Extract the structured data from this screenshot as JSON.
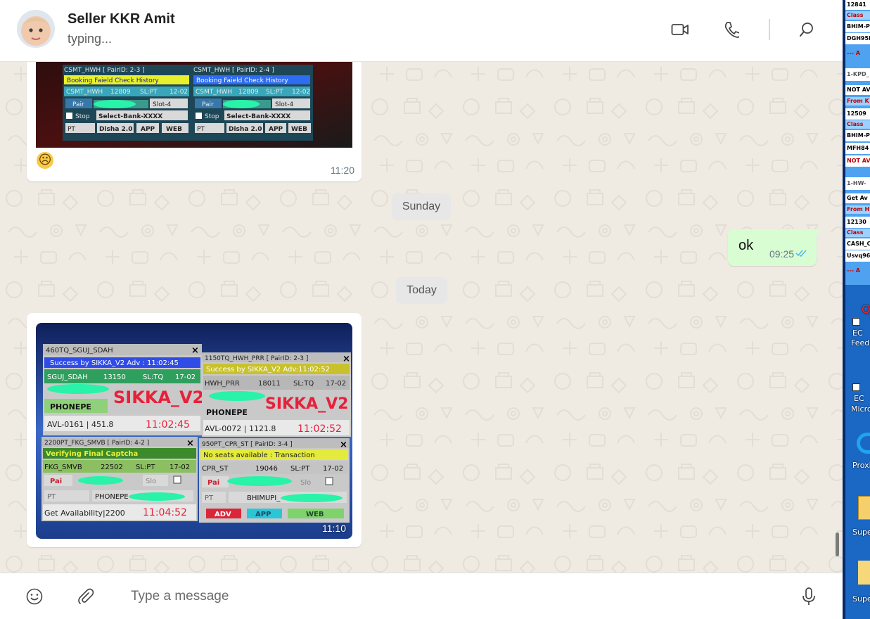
{
  "header": {
    "contact_name": "Seller KKR Amit",
    "contact_status": "typing...",
    "icons": [
      "video-call-icon",
      "voice-call-icon",
      "search-icon"
    ]
  },
  "messages": {
    "msg1": {
      "direction": "in",
      "type": "image",
      "caption_emoji": "☹",
      "time": "11:20"
    },
    "date_sunday": "Sunday",
    "msg2": {
      "direction": "out",
      "text": "ok",
      "time": "09:25",
      "status": "read"
    },
    "date_today": "Today",
    "msg3": {
      "direction": "in",
      "type": "image",
      "time": "11:10"
    }
  },
  "image1": {
    "panel_a": {
      "title": "CSMT_HWH [ PairID: 2-3 ]",
      "banner": "Booking Faield Check History",
      "route": "CSMT_HWH",
      "train": "12809",
      "sl": "SL:PT",
      "date": "12-02",
      "pair_btn": "Pair",
      "slot": "Slot-4",
      "stop": "Stop",
      "bank": "Select-Bank-XXXX",
      "quota": "PT",
      "disha": "Disha 2.0",
      "app": "APP",
      "web": "WEB"
    },
    "panel_b": {
      "title": "CSMT_HWH [ PairID: 2-4 ]",
      "banner": "Booking Faield Check History",
      "route": "CSMT_HWH",
      "train": "12809",
      "sl": "SL:PT",
      "date": "12-02",
      "pair_btn": "Pair",
      "slot": "Slot-4",
      "stop": "Stop",
      "bank": "Select-Bank-XXXX",
      "quota": "PT",
      "disha": "Disha 2.0",
      "app": "APP",
      "web": "WEB"
    }
  },
  "image2": {
    "w1": {
      "title": "460TQ_SGUJ_SDAH",
      "banner": "Success by SIKKA_V2 Adv : 11:02:45",
      "route": "SGUJ_SDAH",
      "train": "13150",
      "sl": "SL:TQ",
      "date": "17-02",
      "brand": "SIKKA_V2",
      "pay": "PHONEPE",
      "avl": "AVL-0161 | 451.8",
      "clock": "11:02:45"
    },
    "w2": {
      "title": "1150TQ_HWH_PRR [ PairID: 2-3 ]",
      "banner": "Success by SIKKA_V2 Adv:11:02:52",
      "route": "HWH_PRR",
      "train": "18011",
      "sl": "SL:TQ",
      "date": "17-02",
      "brand": "SIKKA_V2",
      "pay": "PHONEPE",
      "avl": "AVL-0072 | 1121.8",
      "clock": "11:02:52"
    },
    "w3": {
      "title": "2200PT_FKG_SMVB [ PairID: 4-2 ]",
      "banner": "Verifying Final Captcha",
      "route": "FKG_SMVB",
      "train": "22502",
      "sl": "SL:PT",
      "date": "17-02",
      "pair": "Pai",
      "slot": "Slo",
      "quota": "PT",
      "pay": "PHONEPE",
      "avl": "Get Availability|2200",
      "clock": "11:04:52"
    },
    "w4": {
      "title": "950PT_CPR_ST [ PairID: 3-4 ]",
      "banner": "No seats available : Transaction",
      "route": "CPR_ST",
      "train": "19046",
      "sl": "SL:PT",
      "date": "17-02",
      "pair": "Pai",
      "slot": "Slo",
      "quota": "PT",
      "pay": "BHIMUPI_",
      "adv": "ADV",
      "app": "APP",
      "web": "WEB"
    }
  },
  "composer": {
    "placeholder": "Type a message",
    "icons": [
      "emoji-icon",
      "attach-icon",
      "microphone-icon"
    ]
  },
  "desktop_strip": {
    "rows": [
      {
        "text": "12841",
        "fg": "#000",
        "bg": "#ffffff"
      },
      {
        "text": "Class",
        "fg": "#c00000",
        "bg": "#9bd0ff"
      },
      {
        "text": "BHIM-PE",
        "fg": "#000",
        "bg": "#ffffff"
      },
      {
        "text": "DGH95L",
        "fg": "#000",
        "bg": "#ffffff"
      },
      {
        "text": "--- A",
        "fg": "#c00000",
        "bg": "#4fa2f0"
      },
      {
        "text": "1-KPD_",
        "fg": "#555",
        "bg": "#ffffff"
      },
      {
        "text": "NOT AV",
        "fg": "#000",
        "bg": "#ffffff"
      },
      {
        "text": "From K",
        "fg": "#c00000",
        "bg": "#9bd0ff"
      },
      {
        "text": "12509",
        "fg": "#000",
        "bg": "#ffffff"
      },
      {
        "text": "Class",
        "fg": "#c00000",
        "bg": "#9bd0ff"
      },
      {
        "text": "BHIM-PE",
        "fg": "#000",
        "bg": "#ffffff"
      },
      {
        "text": "MFH84",
        "fg": "#000",
        "bg": "#ffffff"
      },
      {
        "text": "NOT AV",
        "fg": "#c00000",
        "bg": "#ffffff"
      },
      {
        "text": "1-HW-",
        "fg": "#555",
        "bg": "#ffffff"
      },
      {
        "text": "Get Av",
        "fg": "#000",
        "bg": "#ffffff"
      },
      {
        "text": "From H",
        "fg": "#c00000",
        "bg": "#9bd0ff"
      },
      {
        "text": "12130",
        "fg": "#000",
        "bg": "#ffffff"
      },
      {
        "text": "Class",
        "fg": "#c00000",
        "bg": "#9bd0ff"
      },
      {
        "text": "CASH_C",
        "fg": "#000",
        "bg": "#ffffff"
      },
      {
        "text": "Usvq96",
        "fg": "#000",
        "bg": "#ffffff"
      },
      {
        "text": "--- A",
        "fg": "#c00000",
        "bg": "#4fa2f0"
      }
    ],
    "icon_labels": [
      "Q",
      "EC",
      "Feedb",
      "EC",
      "Micro",
      "Proxi",
      "Supe",
      "Supe"
    ]
  },
  "colors": {
    "chat_bg": "#efeae2",
    "outgoing_bubble": "#d9fdd3",
    "incoming_bubble": "#ffffff",
    "read_tick": "#53bdeb"
  }
}
